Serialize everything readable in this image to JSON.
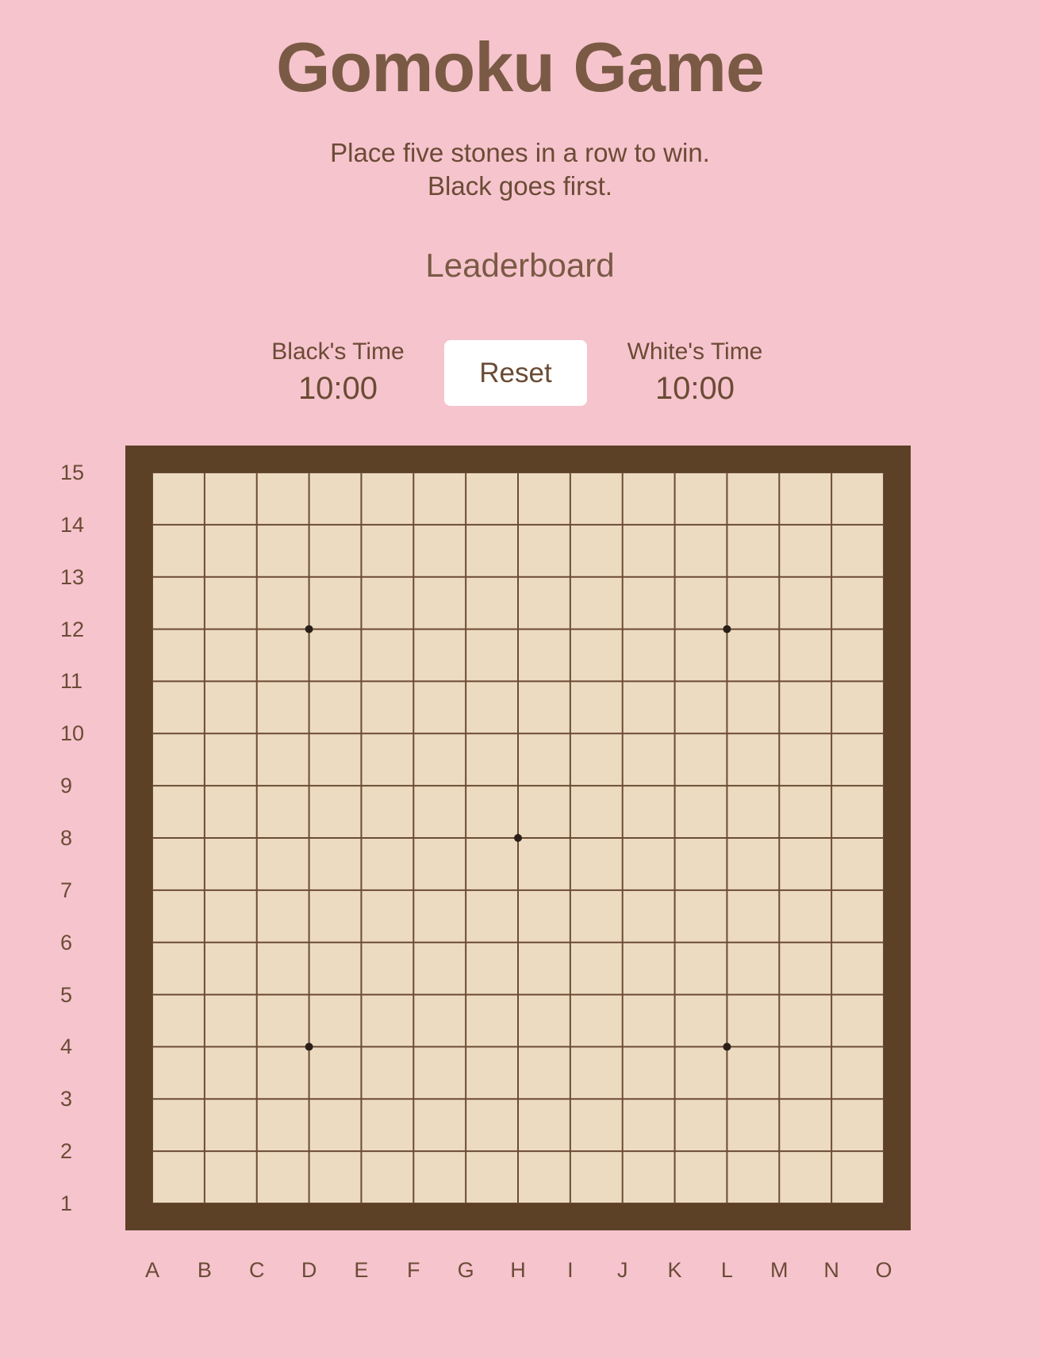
{
  "title": "Gomoku Game",
  "subtitle": {
    "line1": "Place five stones in a row to win.",
    "line2": "Black goes first."
  },
  "leaderboard": "Leaderboard",
  "timers": {
    "black": {
      "label": "Black's Time",
      "value": "10:00"
    },
    "white": {
      "label": "White's Time",
      "value": "10:00"
    }
  },
  "reset_label": "Reset",
  "board": {
    "size": 15,
    "columns": [
      "A",
      "B",
      "C",
      "D",
      "E",
      "F",
      "G",
      "H",
      "I",
      "J",
      "K",
      "L",
      "M",
      "N",
      "O"
    ],
    "rows": [
      "15",
      "14",
      "13",
      "12",
      "11",
      "10",
      "9",
      "8",
      "7",
      "6",
      "5",
      "4",
      "3",
      "2",
      "1"
    ],
    "star_points": [
      "D12",
      "L12",
      "H8",
      "D4",
      "L4"
    ],
    "stones": [],
    "colors": {
      "background": "#f6c4cd",
      "frame": "#5d4127",
      "surface": "#ecdbc1",
      "grid": "#6b4b35",
      "star": "#2a1f18"
    }
  }
}
